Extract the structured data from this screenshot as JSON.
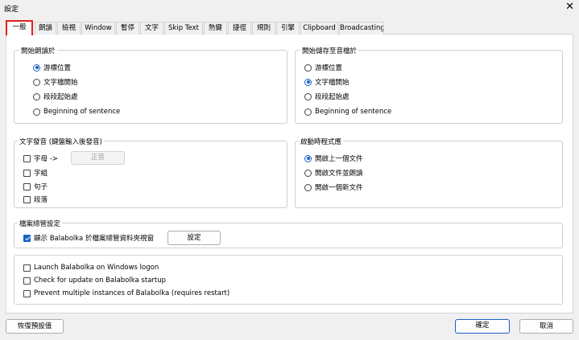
{
  "window": {
    "title": "設定",
    "close_glyph": "✕"
  },
  "tabs": [
    {
      "label": "一般",
      "active": true
    },
    {
      "label": "朗讀"
    },
    {
      "label": "檢視"
    },
    {
      "label": "Window"
    },
    {
      "label": "暫停"
    },
    {
      "label": "文字"
    },
    {
      "label": "Skip Text"
    },
    {
      "label": "熱鍵"
    },
    {
      "label": "捷徑"
    },
    {
      "label": "規則"
    },
    {
      "label": "引擎"
    },
    {
      "label": "Clipboard"
    },
    {
      "label": "Broadcasting"
    }
  ],
  "start_reading": {
    "title": "開始朗讀於",
    "options": [
      {
        "label": "游標位置",
        "selected": true
      },
      {
        "label": "文字檔開始",
        "selected": false
      },
      {
        "label": "段段起始處",
        "selected": false
      },
      {
        "label": "Beginning of sentence",
        "selected": false
      }
    ]
  },
  "start_saving": {
    "title": "開始儲存至音檔於",
    "options": [
      {
        "label": "游標位置",
        "selected": false
      },
      {
        "label": "文字檔開始",
        "selected": true
      },
      {
        "label": "段段起始處",
        "selected": false
      },
      {
        "label": "Beginning of sentence",
        "selected": false
      }
    ]
  },
  "text_pronunciation": {
    "title": "文字發音 (鍵盤輸入後發音)",
    "letters_label": "字母 ->",
    "letters_checked": false,
    "pitch_button": "正音",
    "options": [
      {
        "label": "字組",
        "checked": false
      },
      {
        "label": "句子",
        "checked": false
      },
      {
        "label": "段落",
        "checked": false
      }
    ]
  },
  "startup_mode": {
    "title": "啟動時程式應",
    "options": [
      {
        "label": "開啟上一個文件",
        "selected": true
      },
      {
        "label": "開啟文件並朗讀",
        "selected": false
      },
      {
        "label": "開啟一個新文件",
        "selected": false
      }
    ]
  },
  "file_manager": {
    "title": "檔案總管設定",
    "show_label": "顯示 Balabolka 於檔案總管資料夾視窗",
    "show_checked": true,
    "settings_button": "設定"
  },
  "misc": {
    "options": [
      {
        "label": "Launch Balabolka on Windows logon",
        "checked": false
      },
      {
        "label": "Check for update on Balabolka startup",
        "checked": false
      },
      {
        "label": "Prevent multiple instances of Balabolka (requires restart)",
        "checked": false
      }
    ]
  },
  "footer": {
    "restore_defaults": "恢復預設值",
    "ok": "確定",
    "cancel": "取消"
  }
}
